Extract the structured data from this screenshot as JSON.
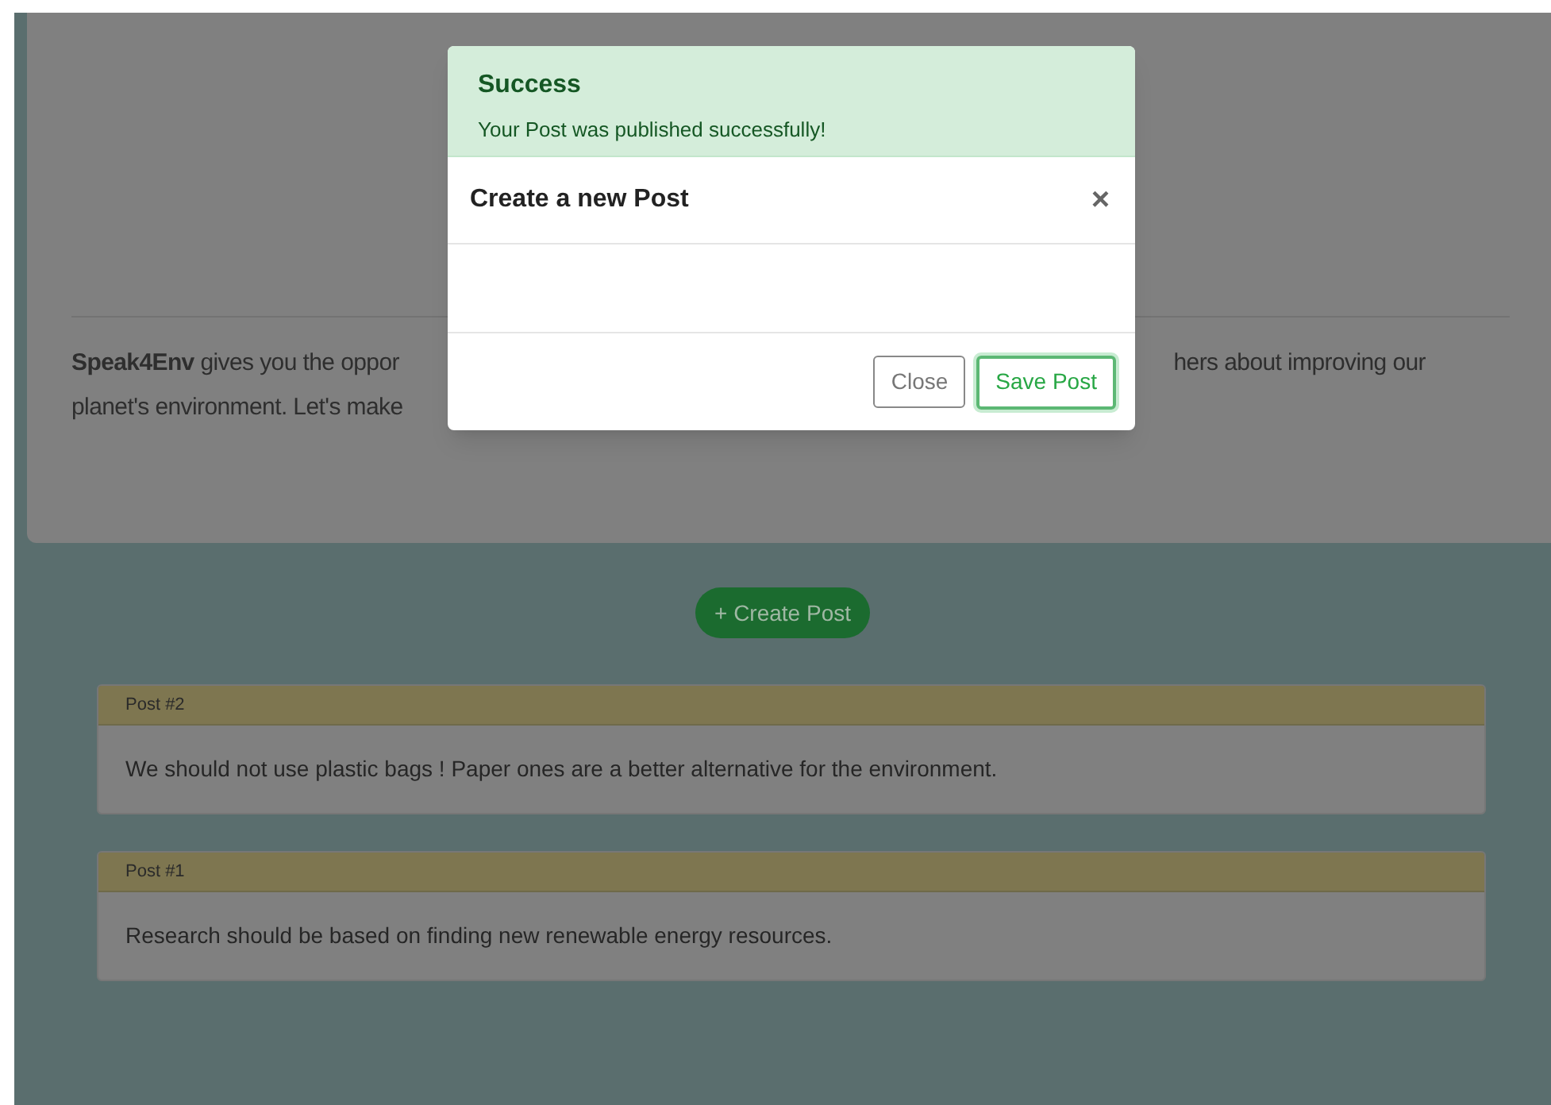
{
  "intro": {
    "left": "**Speak4Env** gives you the oppor",
    "right": "hers about improving our",
    "line_2": "planet's environment. Let's make"
  },
  "create_button": "+ Create Post",
  "posts": [
    {
      "title": "Post #2",
      "body": "We should not use plastic bags ! Paper ones are a better alternative for the environment."
    },
    {
      "title": "Post #1",
      "body": "Research should be based on finding new renewable energy resources."
    }
  ],
  "modal": {
    "alert": {
      "title": "Success",
      "message": "Your Post was published successfully!"
    },
    "title": "Create a new Post",
    "close_icon": "×",
    "buttons": [
      {
        "label": "Close",
        "kind": "secondary"
      },
      {
        "label": "Save Post",
        "kind": "primary"
      }
    ]
  }
}
